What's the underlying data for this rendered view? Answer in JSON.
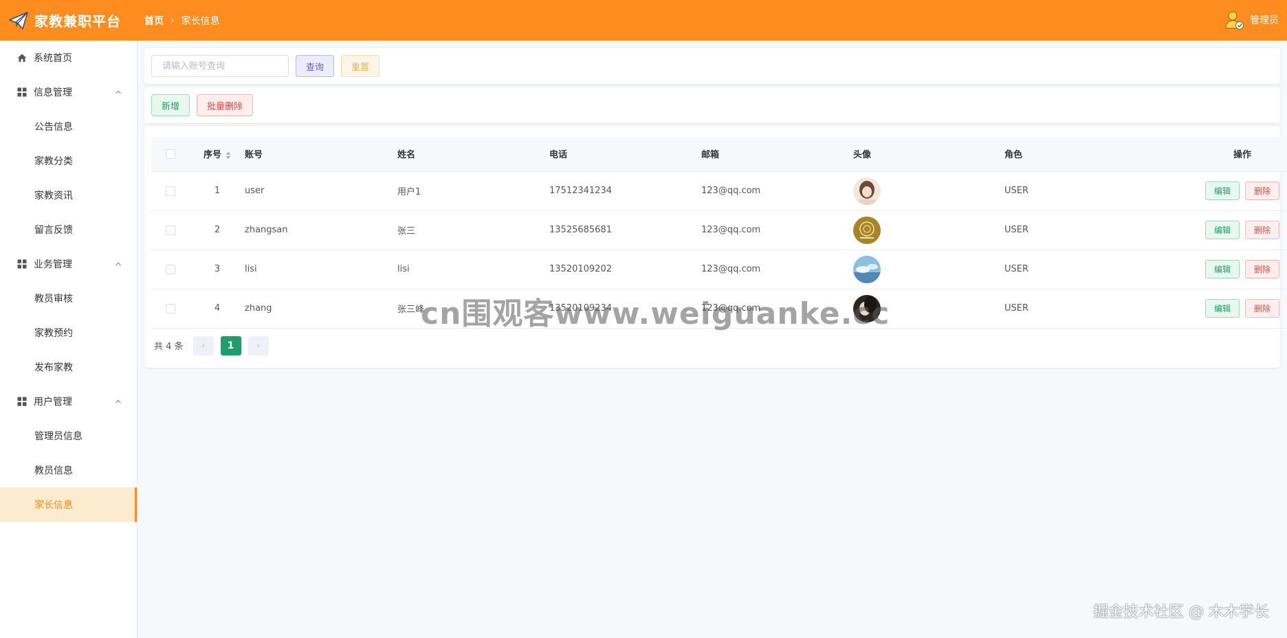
{
  "header": {
    "app_title": "家教兼职平台",
    "breadcrumb_home": "首页",
    "breadcrumb_current": "家长信息",
    "user_label": "管理员",
    "brand_color": "#ff8c1e"
  },
  "sidebar": {
    "home": "系统首页",
    "groups": [
      {
        "label": "信息管理",
        "items": [
          "公告信息",
          "家教分类",
          "家教资讯",
          "留言反馈"
        ]
      },
      {
        "label": "业务管理",
        "items": [
          "教员审核",
          "家教预约",
          "发布家教"
        ]
      },
      {
        "label": "用户管理",
        "items": [
          "管理员信息",
          "教员信息",
          "家长信息"
        ]
      }
    ],
    "active_item": "家长信息"
  },
  "search": {
    "placeholder": "请输入账号查询",
    "query_label": "查询",
    "reset_label": "重置"
  },
  "actions": {
    "add_label": "新增",
    "batch_delete_label": "批量删除"
  },
  "table": {
    "headers": {
      "index": "序号",
      "account": "账号",
      "name": "姓名",
      "phone": "电话",
      "email": "邮箱",
      "avatar": "头像",
      "role": "角色",
      "ops": "操作"
    },
    "rows": [
      {
        "index": "1",
        "account": "user",
        "name": "用户1",
        "phone": "17512341234",
        "email": "123@qq.com",
        "role": "USER"
      },
      {
        "index": "2",
        "account": "zhangsan",
        "name": "张三",
        "phone": "13525685681",
        "email": "123@qq.com",
        "role": "USER"
      },
      {
        "index": "3",
        "account": "lisi",
        "name": "lisi",
        "phone": "13520109202",
        "email": "123@qq.com",
        "role": "USER"
      },
      {
        "index": "4",
        "account": "zhang",
        "name": "张三峰",
        "phone": "13520109234",
        "email": "123@qq.com",
        "role": "USER"
      }
    ],
    "edit_label": "编辑",
    "delete_label": "删除"
  },
  "pagination": {
    "total_text": "共 4 条",
    "current_page": "1",
    "prev_symbol": "‹",
    "next_symbol": "›"
  },
  "overlay": {
    "watermark": "cn围观客www.weiguanke.cc",
    "credit": "掘金技术社区 @ 木木学长"
  }
}
